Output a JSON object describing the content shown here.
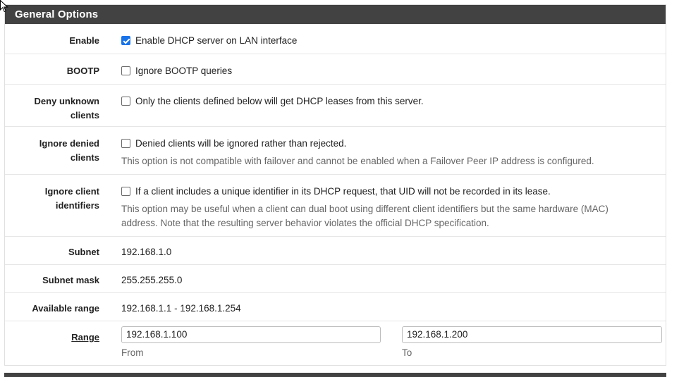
{
  "panel": {
    "title": "General Options"
  },
  "rows": {
    "enable": {
      "label": "Enable",
      "checkbox_text": "Enable DHCP server on LAN interface",
      "checked": true
    },
    "bootp": {
      "label": "BOOTP",
      "checkbox_text": "Ignore BOOTP queries",
      "checked": false
    },
    "deny_unknown": {
      "label_line1": "Deny unknown",
      "label_line2": "clients",
      "checkbox_text": "Only the clients defined below will get DHCP leases from this server.",
      "checked": false
    },
    "ignore_denied": {
      "label_line1": "Ignore denied",
      "label_line2": "clients",
      "checkbox_text": "Denied clients will be ignored rather than rejected.",
      "help": "This option is not compatible with failover and cannot be enabled when a Failover Peer IP address is configured.",
      "checked": false
    },
    "ignore_client_ids": {
      "label_line1": "Ignore client",
      "label_line2": "identifiers",
      "checkbox_text": "If a client includes a unique identifier in its DHCP request, that UID will not be recorded in its lease.",
      "help_line1": "This option may be useful when a client can dual boot using different client identifiers but the same hardware (MAC)",
      "help_line2": "address. Note that the resulting server behavior violates the official DHCP specification.",
      "checked": false
    },
    "subnet": {
      "label": "Subnet",
      "value": "192.168.1.0"
    },
    "subnet_mask": {
      "label": "Subnet mask",
      "value": "255.255.255.0"
    },
    "available_range": {
      "label": "Available range",
      "value": "192.168.1.1 - 192.168.1.254"
    },
    "range": {
      "label": "Range",
      "from_value": "192.168.1.100",
      "from_label": "From",
      "to_value": "192.168.1.200",
      "to_label": "To"
    }
  }
}
